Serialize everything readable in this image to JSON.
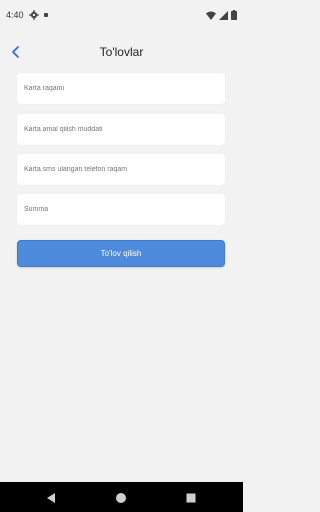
{
  "status_bar": {
    "time": "4:40"
  },
  "header": {
    "title": "To'lovlar"
  },
  "form": {
    "fields": [
      {
        "placeholder": "Karta raqami"
      },
      {
        "placeholder": "Karta amal qilish muddati"
      },
      {
        "placeholder": "Karta sms ulangan telefon raqam"
      },
      {
        "placeholder": "Summa"
      }
    ],
    "submit_label": "To'lov qilish"
  },
  "colors": {
    "background": "#f2f2f2",
    "accent": "#4f8bdc",
    "back_arrow": "#2f6fe0"
  },
  "icons": {
    "status_left": [
      "gear-icon",
      "notification-dot-icon"
    ],
    "status_right": [
      "wifi-icon",
      "cellular-icon",
      "battery-icon"
    ],
    "nav": [
      "back-triangle-icon",
      "home-circle-icon",
      "recents-square-icon"
    ]
  }
}
